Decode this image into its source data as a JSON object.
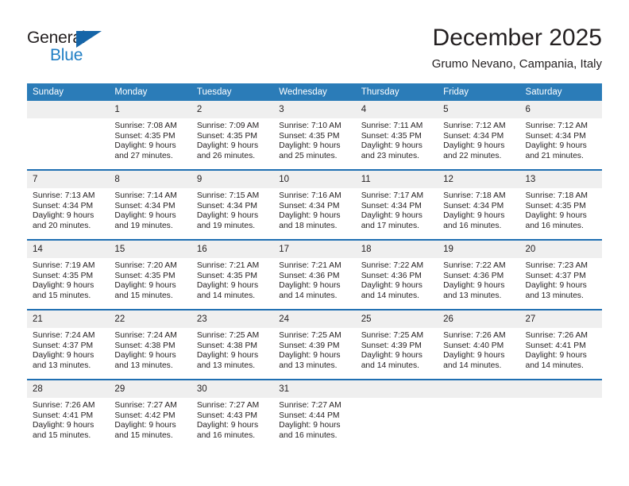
{
  "brand": {
    "name_part1": "General",
    "name_part2": "Blue",
    "accent_color": "#1f7ec4",
    "triangle_color": "#1565a8"
  },
  "header": {
    "title": "December 2025",
    "location": "Grumo Nevano, Campania, Italy"
  },
  "calendar": {
    "header_bg": "#2b7cb8",
    "daynum_bg": "#efefef",
    "rule_color": "#1f6fb2",
    "weekday_headers": [
      "Sunday",
      "Monday",
      "Tuesday",
      "Wednesday",
      "Thursday",
      "Friday",
      "Saturday"
    ],
    "weeks": [
      [
        {
          "day": "",
          "empty": true
        },
        {
          "day": "1",
          "sunrise": "Sunrise: 7:08 AM",
          "sunset": "Sunset: 4:35 PM",
          "daylight_line1": "Daylight: 9 hours",
          "daylight_line2": "and 27 minutes."
        },
        {
          "day": "2",
          "sunrise": "Sunrise: 7:09 AM",
          "sunset": "Sunset: 4:35 PM",
          "daylight_line1": "Daylight: 9 hours",
          "daylight_line2": "and 26 minutes."
        },
        {
          "day": "3",
          "sunrise": "Sunrise: 7:10 AM",
          "sunset": "Sunset: 4:35 PM",
          "daylight_line1": "Daylight: 9 hours",
          "daylight_line2": "and 25 minutes."
        },
        {
          "day": "4",
          "sunrise": "Sunrise: 7:11 AM",
          "sunset": "Sunset: 4:35 PM",
          "daylight_line1": "Daylight: 9 hours",
          "daylight_line2": "and 23 minutes."
        },
        {
          "day": "5",
          "sunrise": "Sunrise: 7:12 AM",
          "sunset": "Sunset: 4:34 PM",
          "daylight_line1": "Daylight: 9 hours",
          "daylight_line2": "and 22 minutes."
        },
        {
          "day": "6",
          "sunrise": "Sunrise: 7:12 AM",
          "sunset": "Sunset: 4:34 PM",
          "daylight_line1": "Daylight: 9 hours",
          "daylight_line2": "and 21 minutes."
        }
      ],
      [
        {
          "day": "7",
          "sunrise": "Sunrise: 7:13 AM",
          "sunset": "Sunset: 4:34 PM",
          "daylight_line1": "Daylight: 9 hours",
          "daylight_line2": "and 20 minutes."
        },
        {
          "day": "8",
          "sunrise": "Sunrise: 7:14 AM",
          "sunset": "Sunset: 4:34 PM",
          "daylight_line1": "Daylight: 9 hours",
          "daylight_line2": "and 19 minutes."
        },
        {
          "day": "9",
          "sunrise": "Sunrise: 7:15 AM",
          "sunset": "Sunset: 4:34 PM",
          "daylight_line1": "Daylight: 9 hours",
          "daylight_line2": "and 19 minutes."
        },
        {
          "day": "10",
          "sunrise": "Sunrise: 7:16 AM",
          "sunset": "Sunset: 4:34 PM",
          "daylight_line1": "Daylight: 9 hours",
          "daylight_line2": "and 18 minutes."
        },
        {
          "day": "11",
          "sunrise": "Sunrise: 7:17 AM",
          "sunset": "Sunset: 4:34 PM",
          "daylight_line1": "Daylight: 9 hours",
          "daylight_line2": "and 17 minutes."
        },
        {
          "day": "12",
          "sunrise": "Sunrise: 7:18 AM",
          "sunset": "Sunset: 4:34 PM",
          "daylight_line1": "Daylight: 9 hours",
          "daylight_line2": "and 16 minutes."
        },
        {
          "day": "13",
          "sunrise": "Sunrise: 7:18 AM",
          "sunset": "Sunset: 4:35 PM",
          "daylight_line1": "Daylight: 9 hours",
          "daylight_line2": "and 16 minutes."
        }
      ],
      [
        {
          "day": "14",
          "sunrise": "Sunrise: 7:19 AM",
          "sunset": "Sunset: 4:35 PM",
          "daylight_line1": "Daylight: 9 hours",
          "daylight_line2": "and 15 minutes."
        },
        {
          "day": "15",
          "sunrise": "Sunrise: 7:20 AM",
          "sunset": "Sunset: 4:35 PM",
          "daylight_line1": "Daylight: 9 hours",
          "daylight_line2": "and 15 minutes."
        },
        {
          "day": "16",
          "sunrise": "Sunrise: 7:21 AM",
          "sunset": "Sunset: 4:35 PM",
          "daylight_line1": "Daylight: 9 hours",
          "daylight_line2": "and 14 minutes."
        },
        {
          "day": "17",
          "sunrise": "Sunrise: 7:21 AM",
          "sunset": "Sunset: 4:36 PM",
          "daylight_line1": "Daylight: 9 hours",
          "daylight_line2": "and 14 minutes."
        },
        {
          "day": "18",
          "sunrise": "Sunrise: 7:22 AM",
          "sunset": "Sunset: 4:36 PM",
          "daylight_line1": "Daylight: 9 hours",
          "daylight_line2": "and 14 minutes."
        },
        {
          "day": "19",
          "sunrise": "Sunrise: 7:22 AM",
          "sunset": "Sunset: 4:36 PM",
          "daylight_line1": "Daylight: 9 hours",
          "daylight_line2": "and 13 minutes."
        },
        {
          "day": "20",
          "sunrise": "Sunrise: 7:23 AM",
          "sunset": "Sunset: 4:37 PM",
          "daylight_line1": "Daylight: 9 hours",
          "daylight_line2": "and 13 minutes."
        }
      ],
      [
        {
          "day": "21",
          "sunrise": "Sunrise: 7:24 AM",
          "sunset": "Sunset: 4:37 PM",
          "daylight_line1": "Daylight: 9 hours",
          "daylight_line2": "and 13 minutes."
        },
        {
          "day": "22",
          "sunrise": "Sunrise: 7:24 AM",
          "sunset": "Sunset: 4:38 PM",
          "daylight_line1": "Daylight: 9 hours",
          "daylight_line2": "and 13 minutes."
        },
        {
          "day": "23",
          "sunrise": "Sunrise: 7:25 AM",
          "sunset": "Sunset: 4:38 PM",
          "daylight_line1": "Daylight: 9 hours",
          "daylight_line2": "and 13 minutes."
        },
        {
          "day": "24",
          "sunrise": "Sunrise: 7:25 AM",
          "sunset": "Sunset: 4:39 PM",
          "daylight_line1": "Daylight: 9 hours",
          "daylight_line2": "and 13 minutes."
        },
        {
          "day": "25",
          "sunrise": "Sunrise: 7:25 AM",
          "sunset": "Sunset: 4:39 PM",
          "daylight_line1": "Daylight: 9 hours",
          "daylight_line2": "and 14 minutes."
        },
        {
          "day": "26",
          "sunrise": "Sunrise: 7:26 AM",
          "sunset": "Sunset: 4:40 PM",
          "daylight_line1": "Daylight: 9 hours",
          "daylight_line2": "and 14 minutes."
        },
        {
          "day": "27",
          "sunrise": "Sunrise: 7:26 AM",
          "sunset": "Sunset: 4:41 PM",
          "daylight_line1": "Daylight: 9 hours",
          "daylight_line2": "and 14 minutes."
        }
      ],
      [
        {
          "day": "28",
          "sunrise": "Sunrise: 7:26 AM",
          "sunset": "Sunset: 4:41 PM",
          "daylight_line1": "Daylight: 9 hours",
          "daylight_line2": "and 15 minutes."
        },
        {
          "day": "29",
          "sunrise": "Sunrise: 7:27 AM",
          "sunset": "Sunset: 4:42 PM",
          "daylight_line1": "Daylight: 9 hours",
          "daylight_line2": "and 15 minutes."
        },
        {
          "day": "30",
          "sunrise": "Sunrise: 7:27 AM",
          "sunset": "Sunset: 4:43 PM",
          "daylight_line1": "Daylight: 9 hours",
          "daylight_line2": "and 16 minutes."
        },
        {
          "day": "31",
          "sunrise": "Sunrise: 7:27 AM",
          "sunset": "Sunset: 4:44 PM",
          "daylight_line1": "Daylight: 9 hours",
          "daylight_line2": "and 16 minutes."
        },
        {
          "day": "",
          "empty": true
        },
        {
          "day": "",
          "empty": true
        },
        {
          "day": "",
          "empty": true
        }
      ]
    ]
  }
}
